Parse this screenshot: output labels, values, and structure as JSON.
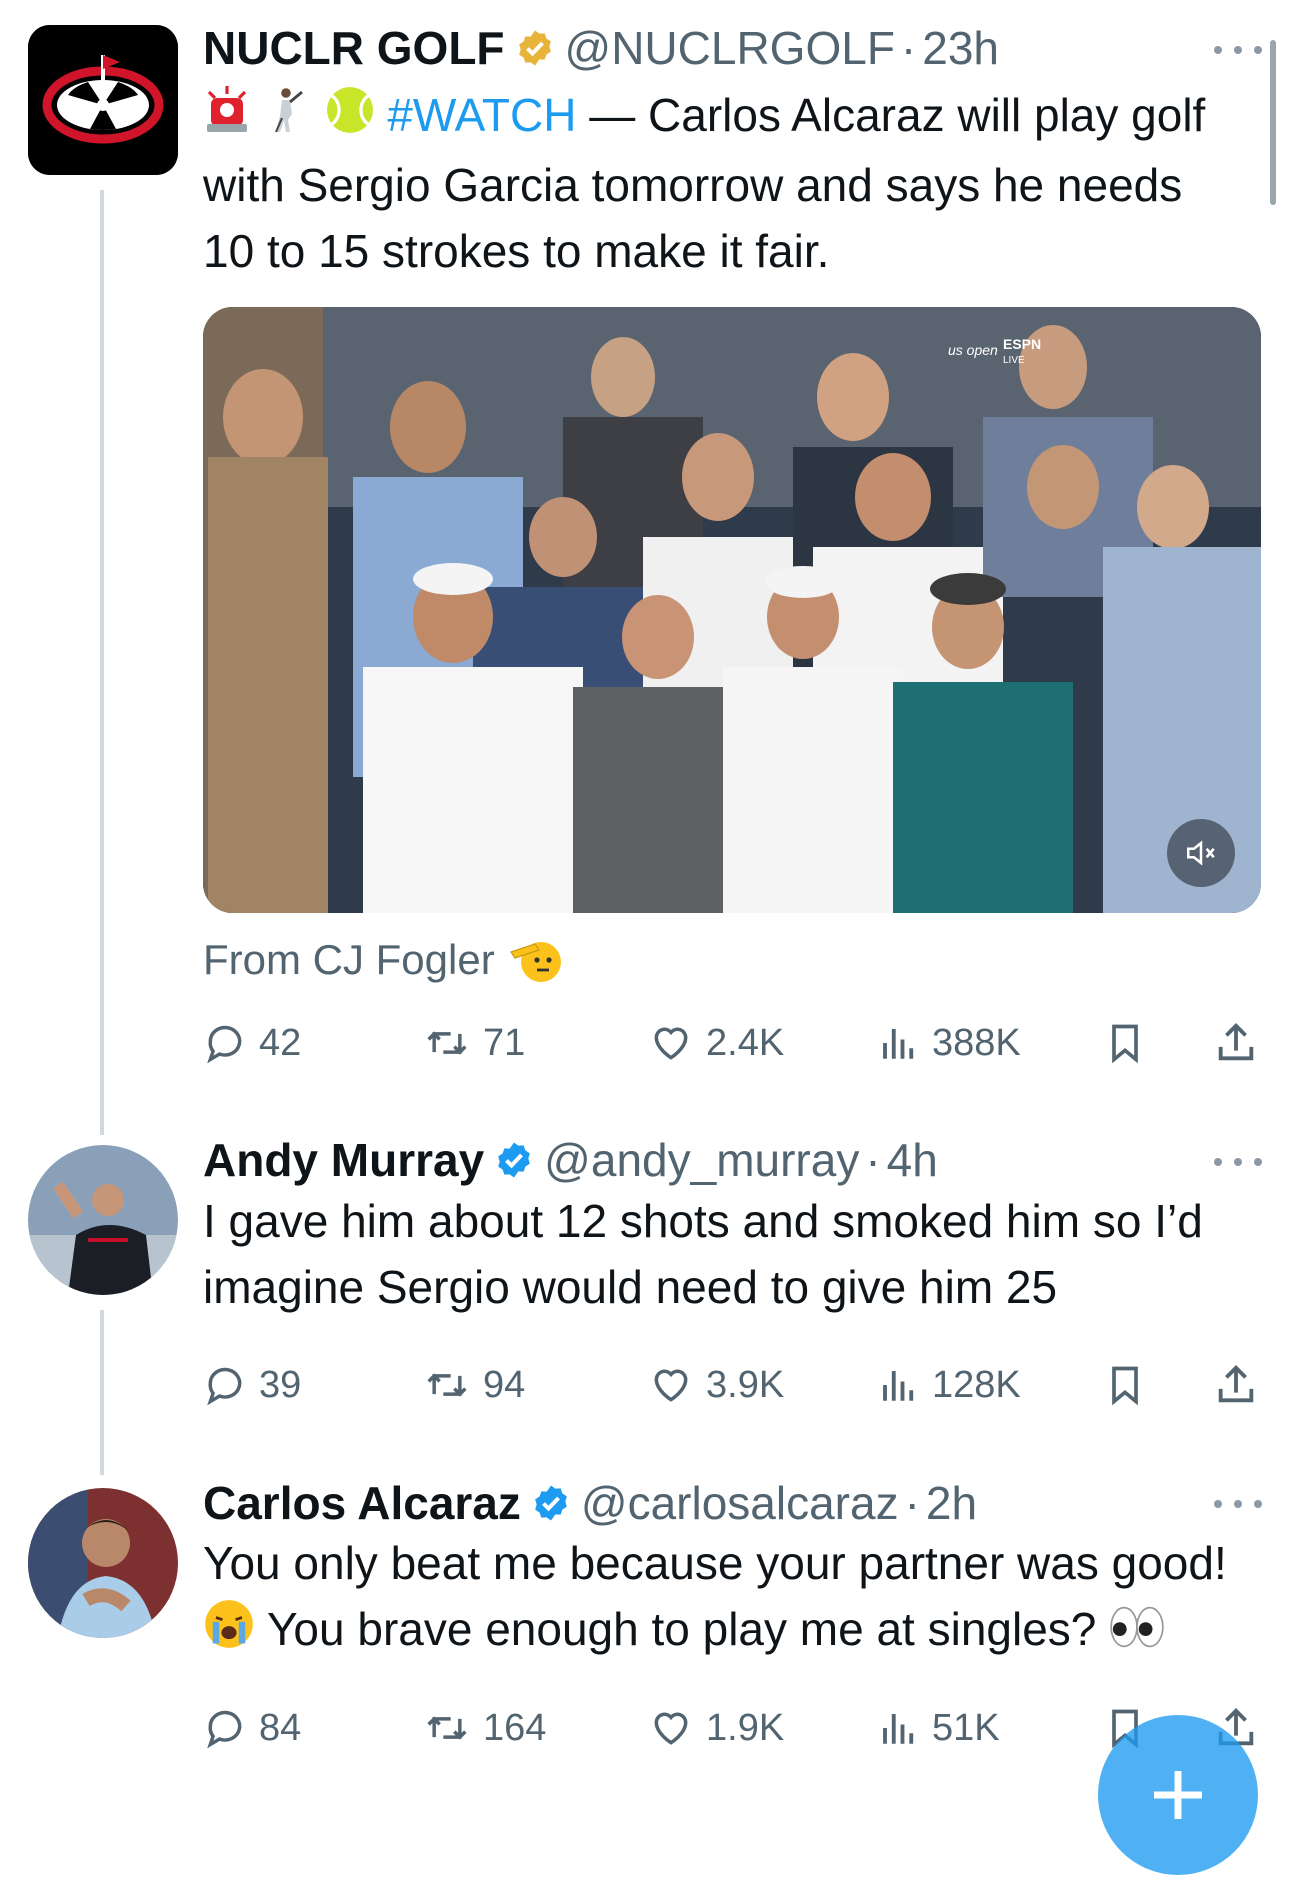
{
  "tweets": [
    {
      "name": "NUCLR GOLF",
      "handle": "@NUCLRGOLF",
      "time": "23h",
      "hashtag": "#WATCH",
      "text_after_hashtag": " — Carlos Alcaraz will play golf with Sergio Garcia tomorrow and says he needs 10 to 15 strokes to make it fair.",
      "emojis": [
        "police-light-icon",
        "golfer-icon",
        "tennis-ball-icon"
      ],
      "media_overlay": "us open",
      "media_overlay_2": "ESPN",
      "media_overlay_3": "LIVE",
      "attribution": "From CJ Fogler",
      "stats": {
        "replies": "42",
        "reposts": "71",
        "likes": "2.4K",
        "views": "388K"
      }
    },
    {
      "name": "Andy Murray",
      "handle": "@andy_murray",
      "time": "4h",
      "text": "I gave him about 12 shots and smoked him so I’d imagine Sergio would need to give him 25",
      "stats": {
        "replies": "39",
        "reposts": "94",
        "likes": "3.9K",
        "views": "128K"
      }
    },
    {
      "name": "Carlos Alcaraz",
      "handle": "@carlosalcaraz",
      "time": "2h",
      "text_part1": "You only beat me because your partner was good! ",
      "text_part2": " You brave enough to play me at singles? ",
      "emojis": [
        "crying-face-icon",
        "eyes-icon"
      ],
      "stats": {
        "replies": "84",
        "reposts": "164",
        "likes": "1.9K",
        "views": "51K"
      }
    }
  ],
  "colors": {
    "primary_text": "#0f1419",
    "secondary_text": "#536471",
    "link": "#1d9bf0",
    "verified_blue": "#1d9bf0",
    "verified_gold": "#e8b339",
    "fab": "#1d9bf0"
  }
}
